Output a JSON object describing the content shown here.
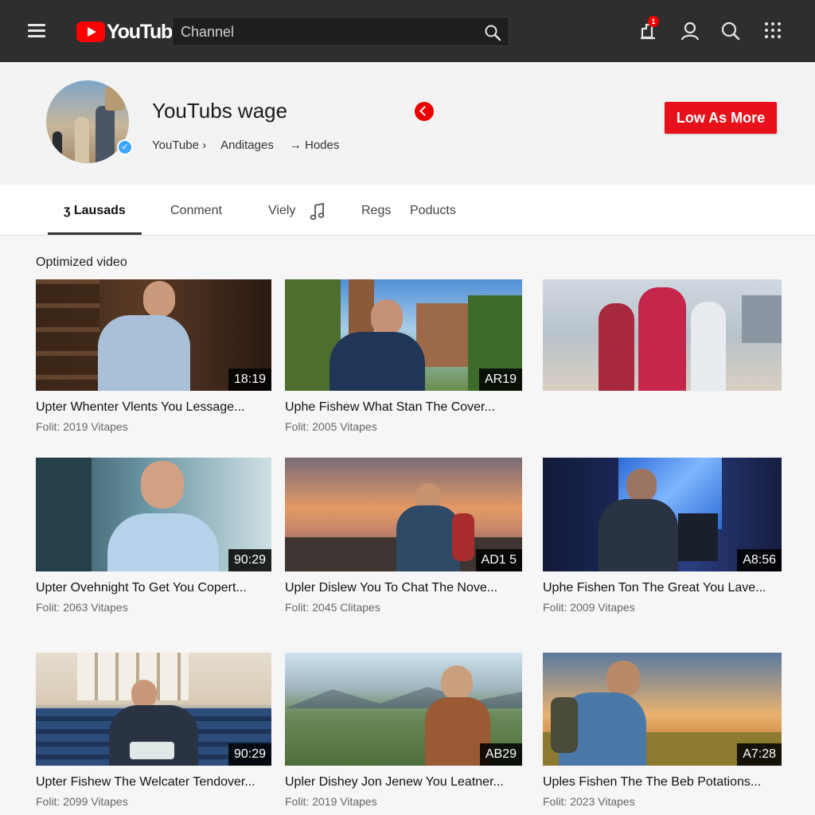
{
  "header": {
    "logo_text": "YouTube",
    "search_placeholder": "Channel",
    "notification_count": "1",
    "colors": {
      "bar": "#2e2e2e",
      "brand": "#ff0000"
    }
  },
  "channel": {
    "title": "YouTubs wage",
    "breadcrumb": [
      "YouTube ›",
      "Anditages",
      "→ Hodes"
    ],
    "subscribe_label": "Low As More",
    "accent": "#e8101a"
  },
  "tabs": [
    {
      "label": "ʒ Lausads",
      "active": true
    },
    {
      "label": "Conment",
      "active": false
    },
    {
      "label": "Viely",
      "active": false
    },
    {
      "label": "Regs",
      "active": false
    },
    {
      "label": "Poducts",
      "active": false
    }
  ],
  "section": {
    "title": "Optimized video"
  },
  "videos": [
    {
      "title": "Upter Whenter Vlents You Lessage...",
      "meta": "Folit: 2019 Vitapes",
      "duration": "18:19"
    },
    {
      "title": "Uphe Fishew What Stan The Cover...",
      "meta": "Folit: 2005 Vitapes",
      "duration": "AR19"
    },
    {
      "title": "",
      "meta": "",
      "duration": ""
    },
    {
      "title": "Upter Ovehnight To Get You Copert...",
      "meta": "Folit: 2063 Vitapes",
      "duration": "90:29"
    },
    {
      "title": "Upler Dislew You To Chat The Nove...",
      "meta": "Folit: 2045 Clitapes",
      "duration": "AD1 5"
    },
    {
      "title": "Uphe Fishen Ton The Great You Lave...",
      "meta": "Folit: 2009 Vitapes",
      "duration": "A8:56"
    },
    {
      "title": "Upter Fishew The Welcater Tendover...",
      "meta": "Folit: 2099 Vitapes",
      "duration": "90:29"
    },
    {
      "title": "Upler Dishey Jon Jenew You Leatner...",
      "meta": "Folit: 2019 Vitapes",
      "duration": "AB29"
    },
    {
      "title": "Uples Fishen The The Beb Potations...",
      "meta": "Folit: 2023 Vitapes",
      "duration": "A7:28"
    }
  ]
}
